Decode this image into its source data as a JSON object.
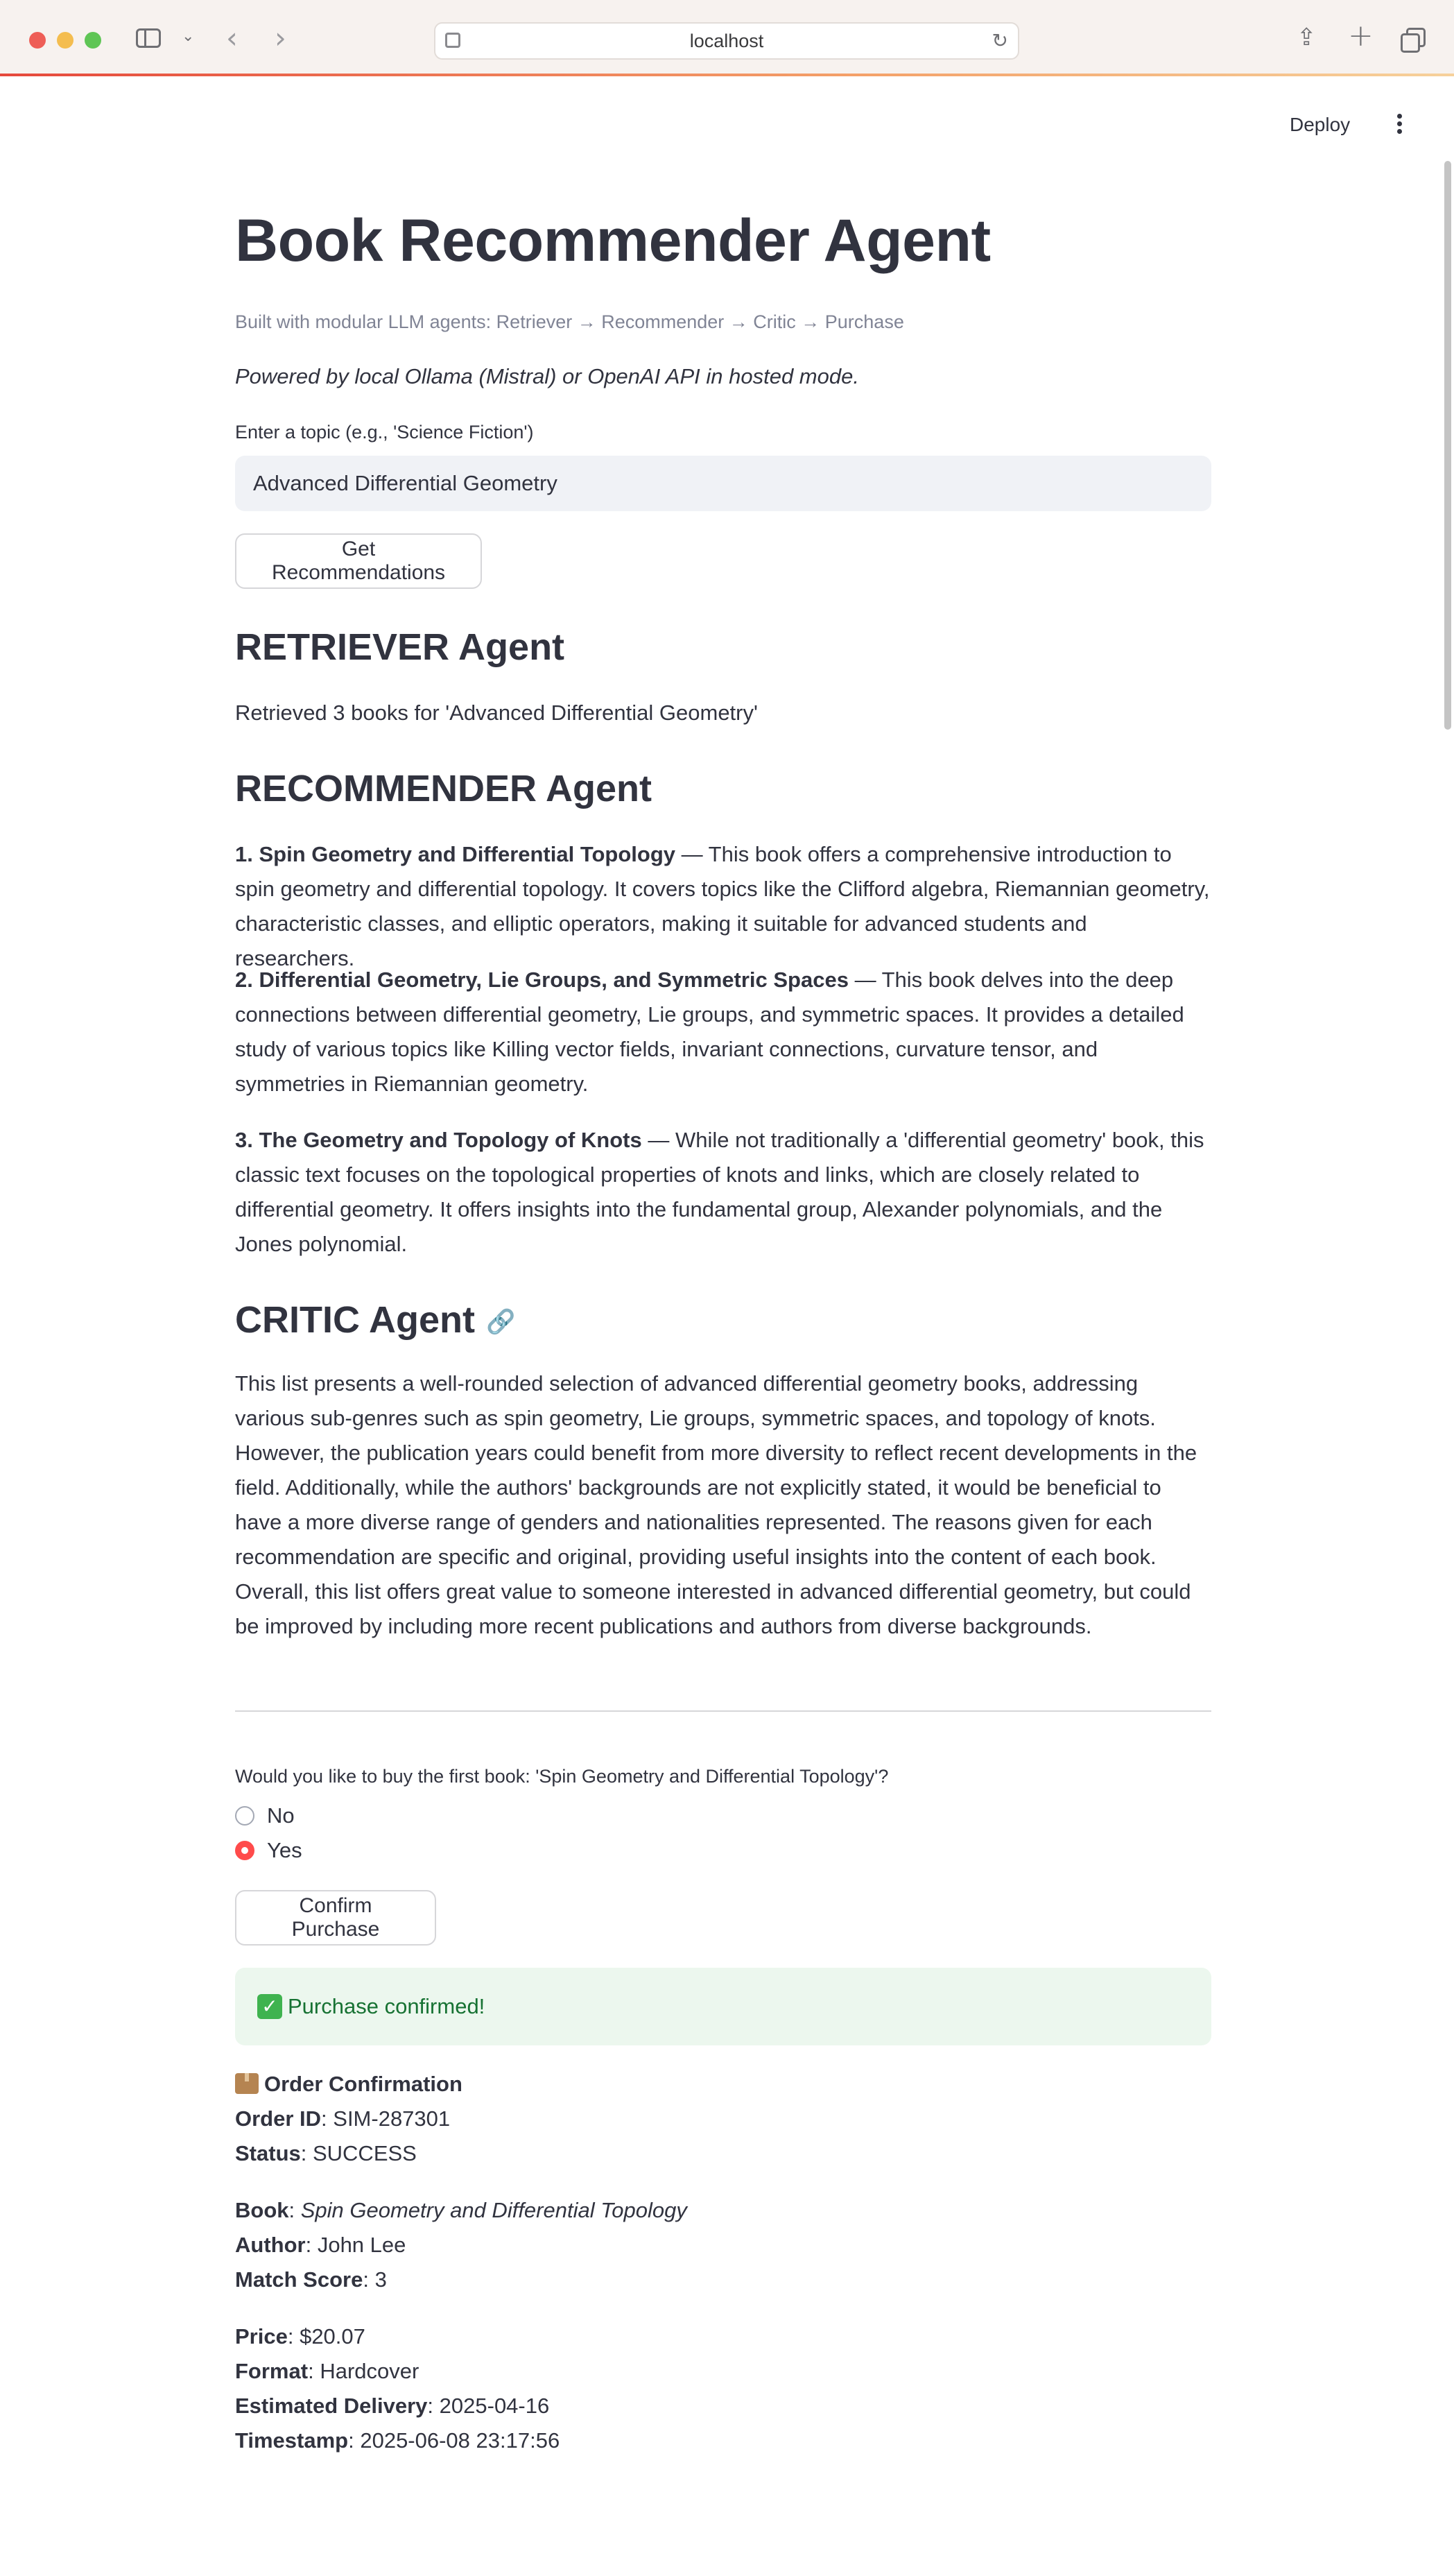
{
  "browser": {
    "url": "localhost"
  },
  "header": {
    "deploy_label": "Deploy"
  },
  "app": {
    "title": "Book Recommender Agent",
    "caption": "Built with modular LLM agents: Retriever → Recommender → Critic → Purchase",
    "powered_by": "Powered by local Ollama (Mistral) or OpenAI API in hosted mode.",
    "topic_label": "Enter a topic (e.g., 'Science Fiction')",
    "topic_value": "Advanced Differential Geometry",
    "get_button": "Get Recommendations"
  },
  "retriever": {
    "heading": "RETRIEVER Agent",
    "text": "Retrieved 3 books for 'Advanced Differential Geometry'"
  },
  "recommender": {
    "heading": "RECOMMENDER Agent",
    "items": [
      {
        "title": "1. Spin Geometry and Differential Topology",
        "description": " — This book offers a comprehensive introduction to spin geometry and differential topology. It covers topics like the Clifford algebra, Riemannian geometry, characteristic classes, and elliptic operators, making it suitable for advanced students and researchers."
      },
      {
        "title": "2. Differential Geometry, Lie Groups, and Symmetric Spaces",
        "description": " — This book delves into the deep connections between differential geometry, Lie groups, and symmetric spaces. It provides a detailed study of various topics like Killing vector fields, invariant connections, curvature tensor, and symmetries in Riemannian geometry."
      },
      {
        "title": "3. The Geometry and Topology of Knots",
        "description": " — While not traditionally a 'differential geometry' book, this classic text focuses on the topological properties of knots and links, which are closely related to differential geometry. It offers insights into the fundamental group, Alexander polynomials, and the Jones polynomial."
      }
    ]
  },
  "critic": {
    "heading": "CRITIC Agent",
    "text": "This list presents a well-rounded selection of advanced differential geometry books, addressing various sub-genres such as spin geometry, Lie groups, symmetric spaces, and topology of knots. However, the publication years could benefit from more diversity to reflect recent developments in the field. Additionally, while the authors' backgrounds are not explicitly stated, it would be beneficial to have a more diverse range of genders and nationalities represented. The reasons given for each recommendation are specific and original, providing useful insights into the content of each book. Overall, this list offers great value to someone interested in advanced differential geometry, but could be improved by including more recent publications and authors from diverse backgrounds."
  },
  "purchase": {
    "question": "Would you like to buy the first book: 'Spin Geometry and Differential Topology'?",
    "options": [
      "No",
      "Yes"
    ],
    "selected": "Yes",
    "confirm_button": "Confirm Purchase",
    "success_message": "Purchase confirmed!",
    "accent_color": "#ff4b4b",
    "success_color": "#177233"
  },
  "order": {
    "heading": "Order Confirmation",
    "order_id_label": "Order ID",
    "order_id": "SIM-287301",
    "status_label": "Status",
    "status": "SUCCESS",
    "book_label": "Book",
    "book": "Spin Geometry and Differential Topology",
    "author_label": "Author",
    "author": "John Lee",
    "match_label": "Match Score",
    "match_score": "3",
    "price_label": "Price",
    "price": "$20.07",
    "format_label": "Format",
    "format": "Hardcover",
    "delivery_label": "Estimated Delivery",
    "delivery": "2025-04-16",
    "timestamp_label": "Timestamp",
    "timestamp": "2025-06-08 23:17:56"
  }
}
